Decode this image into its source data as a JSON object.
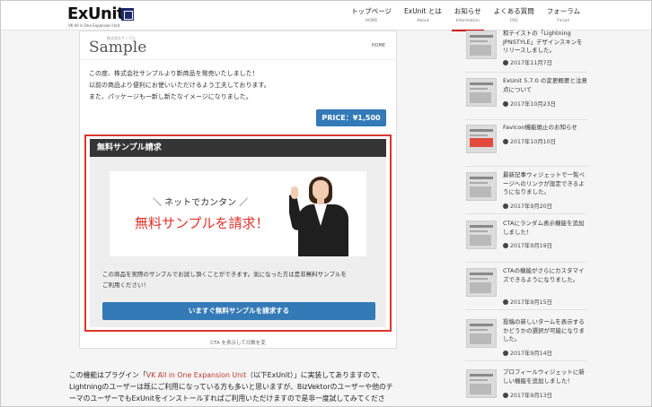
{
  "header": {
    "logo_text": "ExUnit",
    "logo_sub": "VK All in One Expansion Unit",
    "nav": [
      {
        "label": "トップページ",
        "sub": "HOME",
        "active": false
      },
      {
        "label": "ExUnit とは",
        "sub": "About",
        "active": false
      },
      {
        "label": "お知らせ",
        "sub": "Information",
        "active": true
      },
      {
        "label": "よくある質問",
        "sub": "FAQ",
        "active": false
      },
      {
        "label": "フォーラム",
        "sub": "Forum",
        "active": false
      }
    ]
  },
  "mock": {
    "logo": "Sample",
    "logo_sub": "株式会社サンプル",
    "home": "HOME",
    "body_lines": [
      "この度、株式会社サンプルより新商品を発売いたしました！",
      "以前の商品より便利にお使いいただけるよう工夫しております。",
      "また、パッケージも一新し新たなイメージになりました。"
    ],
    "price_label": "PRICE：¥1,500",
    "cta_title": "無料サンプル請求",
    "banner_top": "＼ ネットでカンタン ／",
    "banner_main": "無料サンプルを請求！",
    "cta_text_1": "この商品を実際のサンプルでお試し頂くことができます。気になった方は是非無料サンプルを",
    "cta_text_2": "ご利用ください！",
    "cta_button": "いますぐ無料サンプルを請求する",
    "caption": "CTA を表示して日数を変"
  },
  "article": {
    "line1_pre": "この機能はプラグイン「",
    "line1_link": "VK All in One Expansion Unit",
    "line1_post": "（以下ExUnit）」に実装してありますので、",
    "line2": "Lightningのユーザーは既にご利用になっている方も多いと思いますが、BizVektorのユーザーや他のテ",
    "line3": "ーマのユーザーでもExUnitをインストールすればご利用いただけますので是非一度試してみてくださ"
  },
  "sidebar": {
    "posts": [
      {
        "title": "和テイストの「Lightning JPNSTYLE」デザインスキンをリリースしました。",
        "date": "2017年11月7日"
      },
      {
        "title": "ExUnit 5.7.0 の変更概要と注意点について",
        "date": "2017年10月23日"
      },
      {
        "title": "Favicon機能廃止のお知らせ",
        "date": "2017年10月10日"
      },
      {
        "title": "最新記事ウィジェットで一覧ページへのリンクが設定できるようになりました。",
        "date": "2017年9月20日"
      },
      {
        "title": "CTAにランダム表示機能を追加しました！",
        "date": "2017年9月19日"
      },
      {
        "title": "CTAの機能がさらにカスタマイズできるようになりました。",
        "date": "2017年9月15日"
      },
      {
        "title": "投稿の新しいタームを表示するかどうかの選択が可能になりました。",
        "date": "2017年9月14日"
      },
      {
        "title": "プロフィールウィジェットに新しい機能を追加しました！",
        "date": "2017年9月13日"
      }
    ]
  }
}
